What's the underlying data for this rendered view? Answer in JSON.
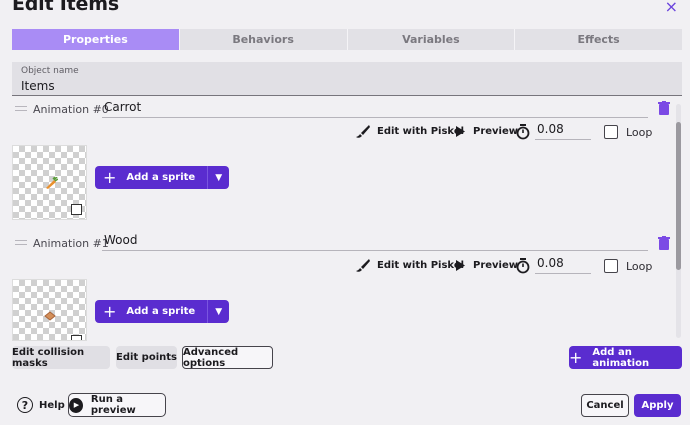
{
  "dialog": {
    "title": "Edit Items",
    "close_label": "×"
  },
  "tabs": [
    {
      "label": "Properties",
      "active": true
    },
    {
      "label": "Behaviors"
    },
    {
      "label": "Variables"
    },
    {
      "label": "Effects"
    }
  ],
  "object_name": {
    "label": "Object name",
    "value": "Items"
  },
  "animations": [
    {
      "label": "Animation #0",
      "name": "Carrot",
      "duration": "0.08",
      "loop": false,
      "sprite": "carrot"
    },
    {
      "label": "Animation #1",
      "name": "Wood",
      "duration": "0.08",
      "loop": false,
      "sprite": "wood"
    }
  ],
  "animation_tools": {
    "edit_label": "Edit with Piskel",
    "preview_label": "Preview",
    "loop_label": "Loop",
    "add_sprite_label": "Add a sprite",
    "add_sprite_plus": "+",
    "dropdown_glyph": "▼"
  },
  "bottom_actions": {
    "edit_collision_masks": "Edit collision masks",
    "edit_points": "Edit points",
    "advanced_options": "Advanced options",
    "add_animation": "Add an animation",
    "add_animation_plus": "+"
  },
  "footer": {
    "help_label": "Help",
    "help_glyph": "?",
    "run_preview_label": "Run a preview",
    "play_glyph": "▶",
    "cancel_label": "Cancel",
    "apply_label": "Apply"
  },
  "colors": {
    "accent": "#5a2ccf",
    "tab_active": "#a98cf5",
    "trash": "#7b4ae5",
    "background": "#f1f0f3"
  },
  "icons": [
    "close-icon",
    "drag-handle-icon",
    "trash-icon",
    "brush-icon",
    "play-icon",
    "timer-icon",
    "plus-icon",
    "chevron-down-icon",
    "help-icon",
    "play-circle-icon"
  ]
}
